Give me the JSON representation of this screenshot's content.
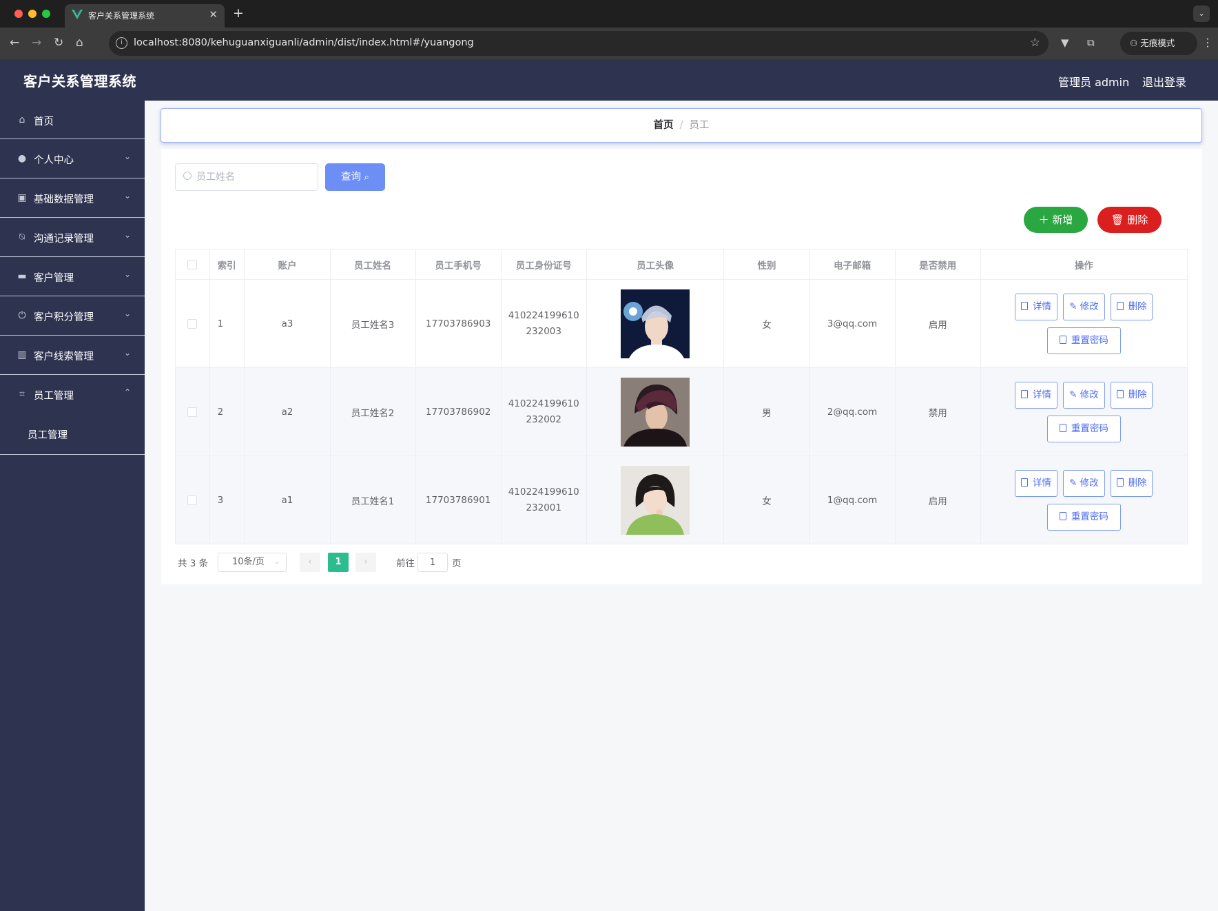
{
  "browser": {
    "tab_title": "客户关系管理系统",
    "url": "localhost:8080/kehuguanxiguanli/admin/dist/index.html#/yuangong",
    "incognito_label": "无痕模式"
  },
  "header": {
    "title": "客户关系管理系统",
    "user": "管理员 admin",
    "logout": "退出登录",
    "bg_color": "#2e3350"
  },
  "sidebar": {
    "items": [
      {
        "label": "首页",
        "icon": "home-icon"
      },
      {
        "label": "个人中心",
        "icon": "user-icon"
      },
      {
        "label": "基础数据管理",
        "icon": "clipboard-icon"
      },
      {
        "label": "沟通记录管理",
        "icon": "bell-off-icon"
      },
      {
        "label": "客户管理",
        "icon": "monitor-icon"
      },
      {
        "label": "客户积分管理",
        "icon": "power-icon"
      },
      {
        "label": "客户线索管理",
        "icon": "bar-chart-icon"
      },
      {
        "label": "员工管理",
        "icon": "crop-icon",
        "expanded": true
      }
    ],
    "submenu_label": "员工管理"
  },
  "breadcrumb": {
    "home": "首页",
    "separator": "/",
    "current": "员工"
  },
  "search": {
    "placeholder": "员工姓名",
    "button": "查询"
  },
  "actions": {
    "add": "新增",
    "delete": "删除",
    "add_color": "#2ba742",
    "delete_color": "#db1f1f"
  },
  "table": {
    "columns": [
      "索引",
      "账户",
      "员工姓名",
      "员工手机号",
      "员工身份证号",
      "员工头像",
      "性别",
      "电子邮箱",
      "是否禁用",
      "操作"
    ],
    "rows": [
      {
        "index": "1",
        "account": "a3",
        "name": "员工姓名3",
        "phone": "17703786903",
        "id_card": "410224199610232003",
        "avatar": "avatar-young-man-stage-light",
        "gender": "女",
        "email": "3@qq.com",
        "status": "启用"
      },
      {
        "index": "2",
        "account": "a2",
        "name": "员工姓名2",
        "phone": "17703786902",
        "id_card": "410224199610232002",
        "avatar": "avatar-young-man-dark-hair",
        "gender": "男",
        "email": "2@qq.com",
        "status": "禁用"
      },
      {
        "index": "3",
        "account": "a1",
        "name": "员工姓名1",
        "phone": "17703786901",
        "id_card": "410224199610232001",
        "avatar": "avatar-young-woman-green-sweater",
        "gender": "女",
        "email": "1@qq.com",
        "status": "启用"
      }
    ],
    "op_labels": {
      "detail": "详情",
      "edit": "修改",
      "delete": "删除",
      "reset_password": "重置密码"
    }
  },
  "pagination": {
    "total": "共 3 条",
    "page_size": "10条/页",
    "current_page": "1",
    "goto_label": "前往",
    "goto_value": "1",
    "page_suffix": "页",
    "active_color": "#2bbd8e"
  }
}
